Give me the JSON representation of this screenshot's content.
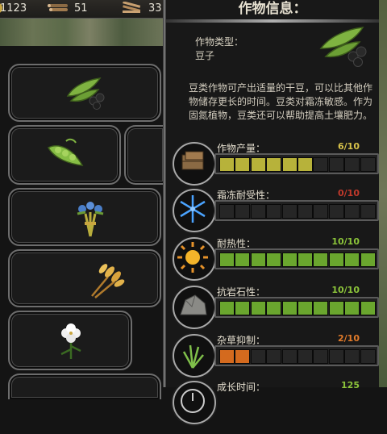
{
  "top": {
    "resources": [
      {
        "icon": "coin-icon",
        "value": "1123"
      },
      {
        "icon": "log-icon",
        "value": "51"
      },
      {
        "icon": "plank-icon",
        "value": "33"
      }
    ]
  },
  "crops": [
    {
      "icon": "soybean-icon"
    },
    {
      "icon": "pea-pod-icon"
    },
    {
      "icon": "flax-bundle-icon"
    },
    {
      "icon": "wheat-icon"
    },
    {
      "icon": "cotton-flower-icon"
    }
  ],
  "panel": {
    "title": "作物信息：",
    "type_label": "作物类型：",
    "type_value": "豆子",
    "type_icon": "soybean-icon",
    "description": "豆类作物可产出适量的干豆，可以比其他作物储存更长的时间。豆类对霜冻敏感。作为固氮植物，豆类还可以帮助提高土壤肥力。"
  },
  "stats": [
    {
      "label": "作物产量：",
      "value": "6/10",
      "level": 6,
      "color": "#b7b23a",
      "value_color": "#d7c24a",
      "icon": "crate-icon"
    },
    {
      "label": "霜冻耐受性：",
      "value": "0/10",
      "level": 0,
      "color": "#c0392b",
      "value_color": "#c0392b",
      "icon": "snowflake-icon"
    },
    {
      "label": "耐热性：",
      "value": "10/10",
      "level": 10,
      "color": "#6aa62e",
      "value_color": "#8cc43a",
      "icon": "sun-icon"
    },
    {
      "label": "抗岩石性：",
      "value": "10/10",
      "level": 10,
      "color": "#6aa62e",
      "value_color": "#8cc43a",
      "icon": "rock-icon"
    },
    {
      "label": "杂草抑制：",
      "value": "2/10",
      "level": 2,
      "color": "#d46a1e",
      "value_color": "#e07a2a",
      "icon": "weed-icon"
    },
    {
      "label": "成长时间：",
      "value": "125",
      "level": 0,
      "color": "#6aa62e",
      "value_color": "#8cc43a",
      "icon": "clock-icon"
    }
  ]
}
